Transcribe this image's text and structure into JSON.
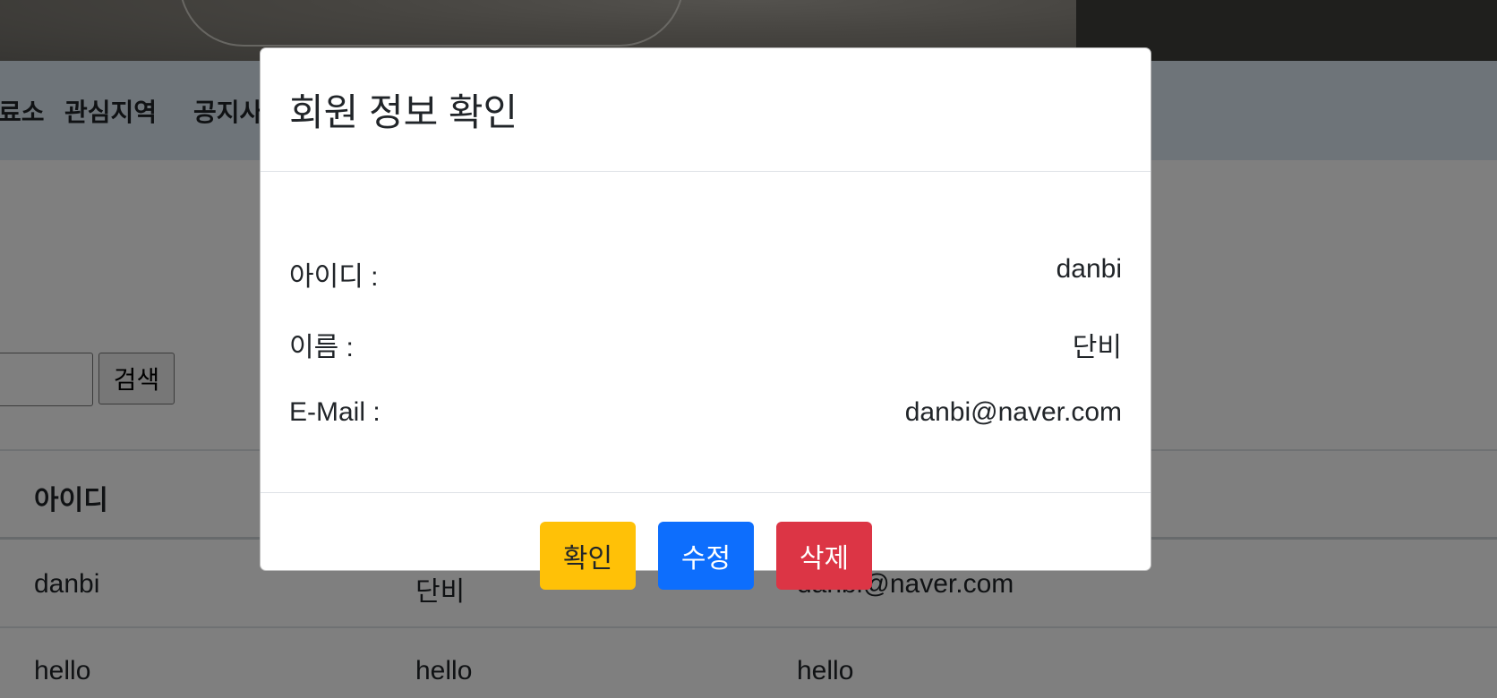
{
  "nav": {
    "items": [
      {
        "label": "료소"
      },
      {
        "label": "관심지역"
      },
      {
        "label": "공지사"
      }
    ]
  },
  "search": {
    "button_label": "검색",
    "value": ""
  },
  "table": {
    "headers": [
      "아이디",
      "",
      ""
    ],
    "rows": [
      {
        "id": "danbi",
        "name": "단비",
        "email": "danbi@naver.com"
      },
      {
        "id": "hello",
        "name": "hello",
        "email": "hello"
      }
    ]
  },
  "modal": {
    "title": "회원 정보 확인",
    "fields": [
      {
        "label": "아이디 :",
        "value": "danbi"
      },
      {
        "label": "이름 :",
        "value": "단비"
      },
      {
        "label": "E-Mail :",
        "value": "danbi@naver.com"
      }
    ],
    "buttons": {
      "confirm": "확인",
      "edit": "수정",
      "delete": "삭제"
    }
  },
  "colors": {
    "confirm": "#ffc107",
    "edit": "#0d6efd",
    "delete": "#dc3545",
    "navbar": "#dde9f3"
  }
}
